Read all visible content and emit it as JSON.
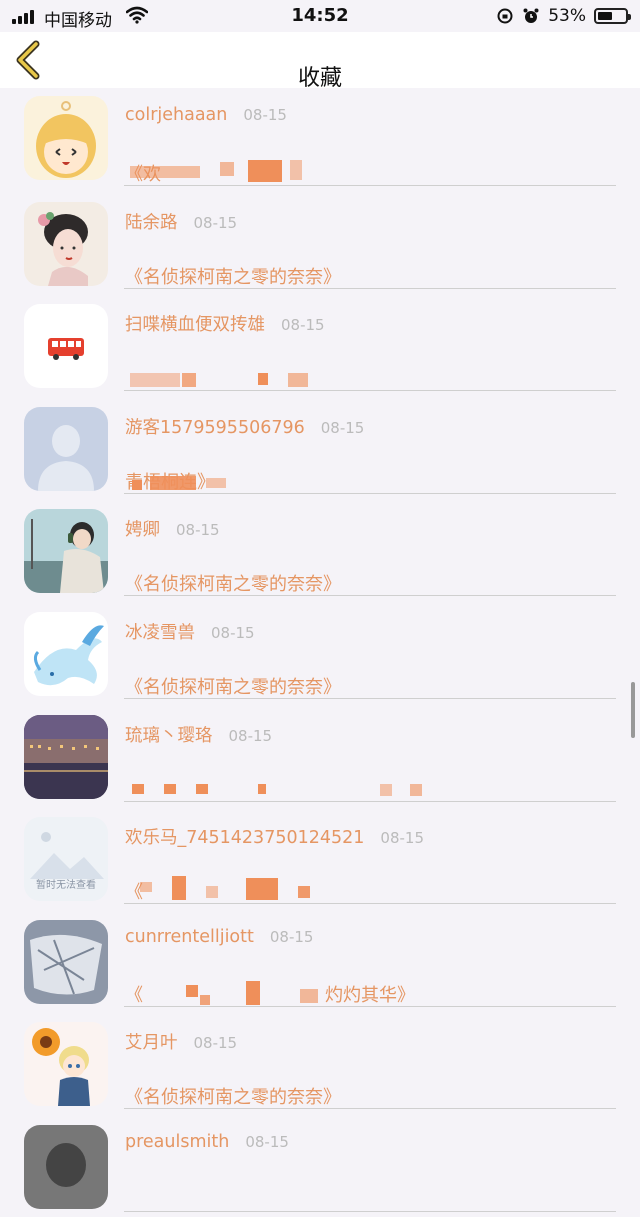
{
  "status_bar": {
    "carrier": "中国移动",
    "time": "14:52",
    "battery": "53%",
    "battery_level": 0.53
  },
  "nav": {
    "title": "收藏",
    "back_icon": "chevron-left-icon"
  },
  "items": [
    {
      "username": "colrjehaaan",
      "date": "08-15",
      "book": "《欢",
      "avatar": "cartoon-girl"
    },
    {
      "username": "陆余路",
      "date": "08-15",
      "book": "《名侦探柯南之零的奈奈》",
      "avatar": "painted-lady"
    },
    {
      "username": "扫喋横血便双抟雄",
      "date": "08-15",
      "book": "",
      "avatar": "red-bus"
    },
    {
      "username": "游客1579595506796",
      "date": "08-15",
      "book": "青梧桐连》",
      "avatar": "default-user"
    },
    {
      "username": "娉卿",
      "date": "08-15",
      "book": "《名侦探柯南之零的奈奈》",
      "avatar": "headphone-girl"
    },
    {
      "username": "冰凌雪兽",
      "date": "08-15",
      "book": "《名侦探柯南之零的奈奈》",
      "avatar": "ice-dragon"
    },
    {
      "username": "琉璃丶璎珞",
      "date": "08-15",
      "book": "",
      "avatar": "night-city"
    },
    {
      "username": "欢乐马_7451423750124521",
      "date": "08-15",
      "book": "《",
      "avatar": "placeholder-image"
    },
    {
      "username": "cunrrentelljiott",
      "date": "08-15",
      "book": "《",
      "book_tail": "灼灼其华》",
      "avatar": "sketch-art"
    },
    {
      "username": "艾月叶",
      "date": "08-15",
      "book": "《名侦探柯南之零的奈奈》",
      "avatar": "anime-boy-flower"
    },
    {
      "username": "preaulsmith",
      "date": "08-15",
      "book": "",
      "avatar": "grey-photo"
    }
  ],
  "placeholder_caption": "暂时无法查看",
  "colors": {
    "accent": "#e59663",
    "date": "#bbbbbb",
    "background": "#f5f3f8",
    "divider": "#cfcfcf",
    "censor": "#ef8f5a"
  }
}
